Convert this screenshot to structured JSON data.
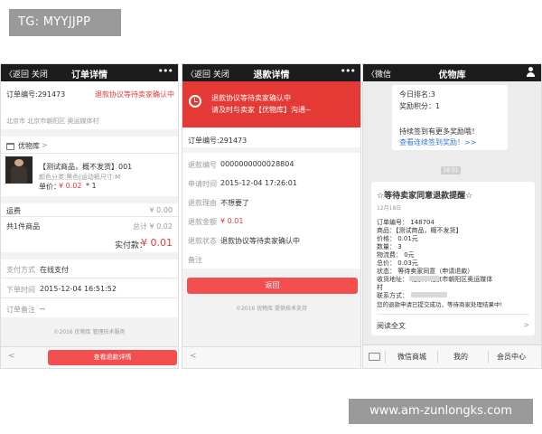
{
  "watermarks": {
    "top_left": "TG: MYYJJPP",
    "bottom_right": "www.am-zunlongks.com"
  },
  "screen1": {
    "nav": {
      "back": "〈返回 关闭",
      "title": "订单详情",
      "more": "•••"
    },
    "order_no": "订单编号:291473",
    "status": "退款协议等待卖家确认中",
    "address": "北京市 北京市朝阳区 奥运媒体村",
    "shop_name": "优物库",
    "product_name": "【测试商品，概不发货】001",
    "product_spec": "颜色分类:黑色|运动裤尺寸:M",
    "price_label": "单价：",
    "price": "¥ 0.02",
    "qty": "* 1",
    "shipping_label": "运费",
    "shipping_value": "¥ 0.00",
    "items_label": "共1件商品",
    "total_label": "总计 ¥ 0.02",
    "paid_label": "实付款：",
    "paid_value": "¥ 0.01",
    "pay_method_label": "支付方式",
    "pay_method_value": "在线支付",
    "order_time_label": "下单时间",
    "order_time_value": "2015-12-04 16:51:52",
    "note_label": "订单备注",
    "note_value": "--",
    "footer_text": "©2016 优物库 管理技术服务",
    "refund_button": "查看退款详情"
  },
  "screen2": {
    "nav": {
      "back": "〈返回 关闭",
      "title": "退款详情",
      "more": "•••"
    },
    "banner_line1": "退款协议等待卖家确认中",
    "banner_line2": "请及时与卖家【优物库】沟通~",
    "order_no": "订单编号:291473",
    "rows": [
      {
        "label": "退款编号",
        "value": "0000000000028804"
      },
      {
        "label": "申请时间",
        "value": "2015-12-04 17:26:01"
      },
      {
        "label": "退款理由",
        "value": "不想要了"
      },
      {
        "label": "退款金额",
        "value": "¥ 0.01"
      },
      {
        "label": "退款状态",
        "value": "退款协议等待卖家确认中"
      },
      {
        "label": "备注",
        "value": ""
      }
    ],
    "return_button": "返回",
    "footer_text": "©2016 优物库 提供技术支持"
  },
  "screen3": {
    "nav": {
      "back": "〈微信",
      "title": "优物库"
    },
    "msg1_line1": "今日排名:3",
    "msg1_line2": "奖励积分：1",
    "msg1_line3": "持续签到有更多奖励哦！",
    "msg1_link": "查看连续签到奖励！>>",
    "time": "18:31",
    "card_title": "☆等待卖家同意退款提醒☆",
    "card_date": "12月18日",
    "card_lines": [
      "订单编号：   148704",
      "商品：【测试商品，概不发货】",
      "价格：      0.01元",
      "数量：      3",
      "物流费：    0元",
      "总价：      0.03元",
      "状态：   等待卖家同意（申请退款）",
      "收货地址：         北京市北京市朝阳区奥运媒体",
      "村",
      "联系方式：",
      "您的退款申请已提交成功，等待商家处理结果中!"
    ],
    "read_more": "阅读全文",
    "menu": [
      "微信商城",
      "我的",
      "会员中心"
    ]
  }
}
